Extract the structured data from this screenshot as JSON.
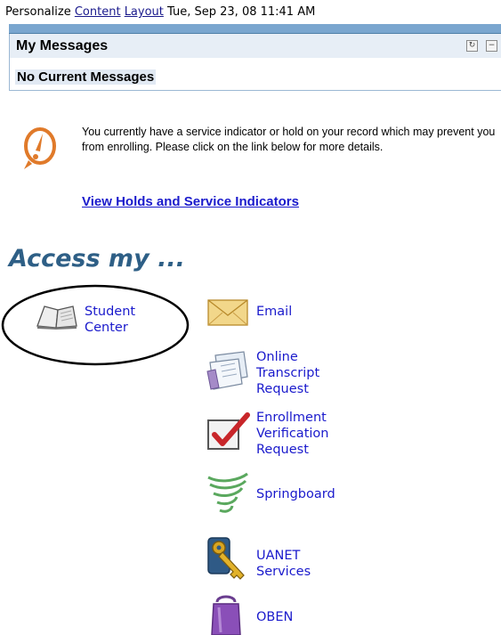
{
  "topbar": {
    "personalize": "Personalize",
    "content": "Content",
    "layout": "Layout",
    "datetime": "Tue, Sep 23, 08 11:41 AM"
  },
  "messages": {
    "title": "My Messages",
    "empty": "No Current Messages"
  },
  "hold": {
    "text": "You currently have a service indicator or hold on your record which may prevent you from enrolling. Please click on the link below for more details.",
    "link": "View Holds and Service Indicators"
  },
  "access": {
    "heading": "Access my ...",
    "items": [
      {
        "line1": "Student",
        "line2": "Center",
        "icon": "book-icon"
      },
      {
        "line1": "Email",
        "icon": "envelope-icon"
      },
      {
        "line1": "Online",
        "line2": "Transcript",
        "line3": "Request",
        "icon": "transcript-icon"
      },
      {
        "line1": "Enrollment",
        "line2": "Verification",
        "line3": "Request",
        "icon": "checkbox-icon"
      },
      {
        "line1": "Springboard",
        "icon": "spring-icon"
      },
      {
        "line1": "UANET",
        "line2": "Services",
        "icon": "key-icon"
      },
      {
        "line1": "OBEN",
        "icon": "purple-bag-icon"
      }
    ]
  },
  "colors": {
    "link": "#1a1acc",
    "heading": "#2e5f86",
    "portlet_band": "#7aa6cf",
    "hold_icon": "#e07a2a"
  }
}
